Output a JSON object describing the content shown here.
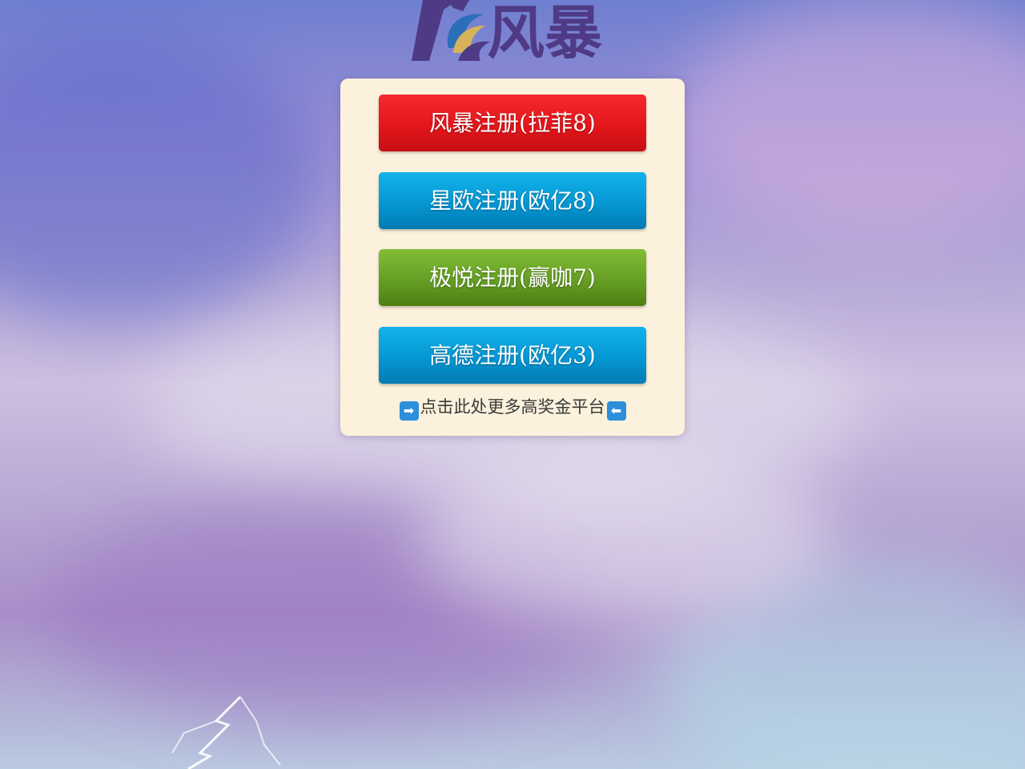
{
  "logo": {
    "icon": "fengbao-logo-icon",
    "text": "风暴",
    "colors": {
      "primary": "#4f3a86",
      "wave_gold": "#d7b35a",
      "wave_blue": "#2a6fb8"
    }
  },
  "buttons": [
    {
      "label": "风暴注册(拉菲8)",
      "color": "#e3161b"
    },
    {
      "label": "星欧注册(欧亿8)",
      "color": "#0597d3"
    },
    {
      "label": "极悦注册(赢咖7)",
      "color": "#659e24"
    },
    {
      "label": "高德注册(欧亿3)",
      "color": "#0597d3"
    }
  ],
  "more_link": {
    "text": "点击此处更多高奖金平台",
    "left_icon": "arrow-right-icon",
    "left_glyph": "➡",
    "right_icon": "arrow-left-icon",
    "right_glyph": "⬅"
  },
  "panel": {
    "background": "#fcf1dc"
  }
}
